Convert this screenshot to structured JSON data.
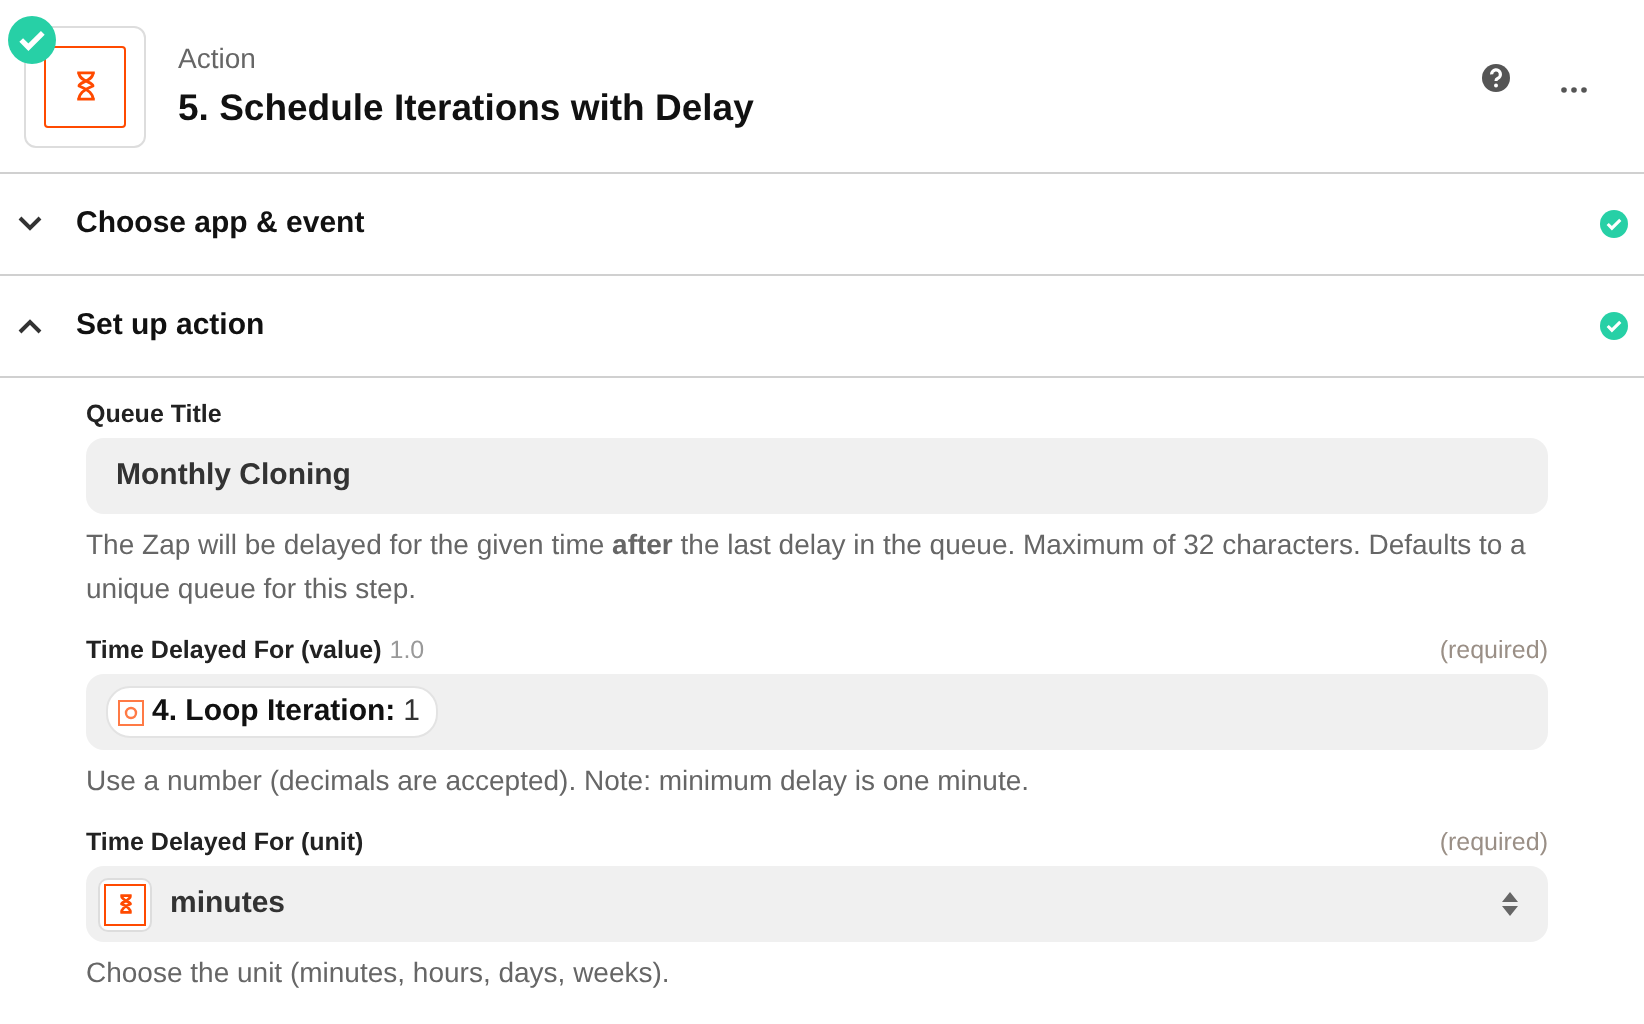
{
  "step": {
    "type_label": "Action",
    "title": "5. Schedule Iterations with Delay",
    "complete": true
  },
  "sections": [
    {
      "title": "Choose app & event",
      "expanded": false,
      "complete": true
    },
    {
      "title": "Set up action",
      "expanded": true,
      "complete": true
    }
  ],
  "fields": [
    {
      "kind": "text",
      "label": "Queue Title",
      "value": "Monthly Cloning",
      "help": "The Zap will be delayed for the given time **after** the last delay in the queue. Maximum of 32 characters. Defaults to a unique queue for this step."
    },
    {
      "kind": "pill",
      "label": "Time Delayed For (value)",
      "hint": "1.0",
      "required": "(required)",
      "pill_label": "4. Loop Iteration:",
      "pill_value": "1",
      "help": "Use a number (decimals are accepted). Note: minimum delay is one minute."
    },
    {
      "kind": "select",
      "label": "Time Delayed For (unit)",
      "required": "(required)",
      "value": "minutes",
      "help": "Choose the unit (minutes, hours, days, weeks)."
    }
  ]
}
